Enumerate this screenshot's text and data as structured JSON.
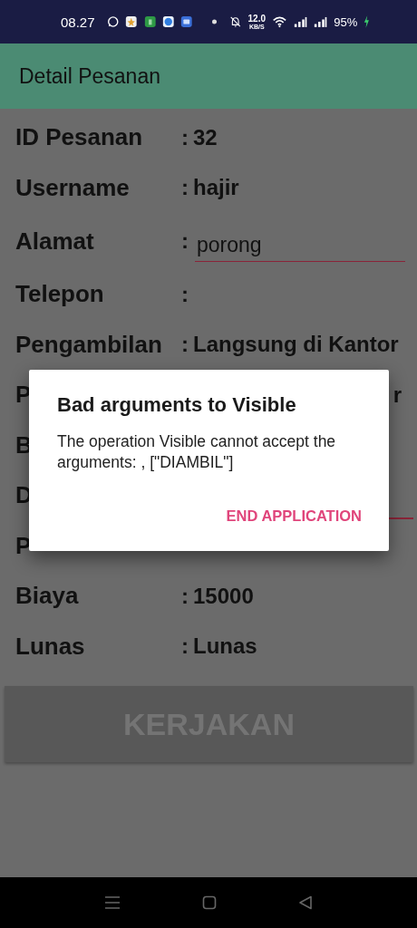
{
  "status_bar": {
    "time": "08.27",
    "speed": "12.0",
    "speed_unit": "KB/S",
    "battery": "95%"
  },
  "app_bar": {
    "title": "Detail Pesanan"
  },
  "rows": [
    {
      "kind": "text",
      "label": "ID Pesanan",
      "colon": ":",
      "value": "32"
    },
    {
      "kind": "text",
      "label": "Username",
      "colon": ":",
      "value": "hajir"
    },
    {
      "kind": "input",
      "label": "Alamat",
      "colon": ":",
      "value": "porong"
    },
    {
      "kind": "text",
      "label": "Telepon",
      "colon": ":"
    },
    {
      "kind": "text",
      "label": "Pengambilan",
      "colon": ":",
      "value": "Langsung di Kantor"
    },
    {
      "kind": "covered",
      "label": "P",
      "value": "r"
    },
    {
      "kind": "covered",
      "label": "B"
    },
    {
      "kind": "covered_input",
      "label": "D"
    },
    {
      "kind": "covered",
      "label": "P"
    },
    {
      "kind": "text",
      "label": "Biaya",
      "colon": ":",
      "value": "15000"
    },
    {
      "kind": "text",
      "label": "Lunas",
      "colon": ":",
      "value": "Lunas"
    }
  ],
  "action_button": {
    "label": "KERJAKAN",
    "disabled": true
  },
  "dialog": {
    "title": "Bad arguments to Visible",
    "message": "The operation Visible cannot accept the arguments: , [\"DIAMBIL\"]",
    "button": "END APPLICATION"
  }
}
